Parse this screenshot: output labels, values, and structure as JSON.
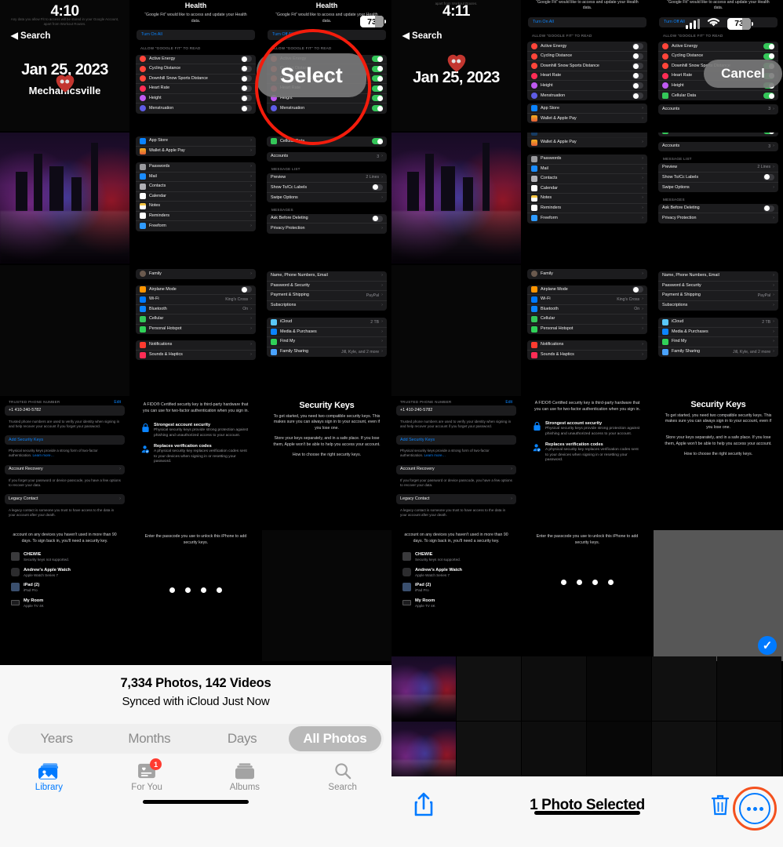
{
  "left_pane": {
    "lock_overlay": {
      "time": "4:10",
      "back_label": "Search",
      "date": "Jan 25, 2023",
      "location": "Mechanicsville",
      "faded_text": "Any data you allow Fit to access will be stored in your Google Account, apart from Workout Routes."
    },
    "health_sheet": {
      "nav_title": "Health",
      "subtitle": "“Google Fit” would like to access and update your Health data.",
      "turn_on_all": "Turn On All",
      "section_header": "ALLOW “GOOGLE FIT” TO READ",
      "items": [
        {
          "label": "Active Energy",
          "on": false
        },
        {
          "label": "Cycling Distance",
          "on": false
        },
        {
          "label": "Downhill Snow Sports Distance",
          "on": false
        },
        {
          "label": "Heart Rate",
          "on": false
        },
        {
          "label": "Height",
          "on": false
        },
        {
          "label": "Menstruation",
          "on": false
        }
      ]
    },
    "health_sheet_on": {
      "nav_title": "Health",
      "subtitle": "“Google Fit” would like to access and update your Health data.",
      "turn_off_all": "Turn Off All",
      "section_header": "ALLOW “GOOGLE FIT” TO READ",
      "items": [
        {
          "label": "Active Energy",
          "on": true
        },
        {
          "label": "Cycling Distance",
          "on": true
        },
        {
          "label": "Downhill Snow Sports Distance",
          "on": true
        },
        {
          "label": "Heart Rate",
          "on": true
        },
        {
          "label": "Height",
          "on": true
        },
        {
          "label": "Menstruation",
          "on": true
        }
      ]
    },
    "settings_apps": {
      "top_rows": [
        {
          "label": "App Store",
          "color": "#0b84ff"
        },
        {
          "label": "Wallet & Apple Pay",
          "color": "#8e8e93"
        }
      ],
      "group_rows": [
        {
          "label": "Passwords",
          "color": "#8e8e93"
        },
        {
          "label": "Mail",
          "color": "#1a8cff"
        },
        {
          "label": "Contacts",
          "color": "#b0b0b5"
        },
        {
          "label": "Calendar",
          "color": "#ffffff"
        },
        {
          "label": "Notes",
          "color": "#f5c542"
        },
        {
          "label": "Reminders",
          "color": "#ffffff"
        },
        {
          "label": "Freeform",
          "color": "#2f9bff"
        }
      ]
    },
    "settings_connectivity": {
      "family_label": "Family",
      "rows": [
        {
          "label": "Airplane Mode",
          "color": "#ff9500",
          "toggle": true,
          "on": false
        },
        {
          "label": "Wi-Fi",
          "color": "#007aff",
          "value": "King's Cross"
        },
        {
          "label": "Bluetooth",
          "color": "#0a84ff",
          "value": "On"
        },
        {
          "label": "Cellular",
          "color": "#34c759"
        },
        {
          "label": "Personal Hotspot",
          "color": "#30d158"
        }
      ],
      "notif_rows": [
        {
          "label": "Notifications",
          "color": "#ff3b30"
        },
        {
          "label": "Sounds & Haptics",
          "color": "#ff2d55"
        }
      ]
    },
    "settings_mail": {
      "cellular_data": {
        "label": "Cellular Data",
        "on": true
      },
      "accounts": {
        "label": "Accounts",
        "value": "3"
      },
      "message_list_header": "MESSAGE LIST",
      "message_list": [
        {
          "label": "Preview",
          "value": "2 Lines"
        },
        {
          "label": "Show To/Cc Labels",
          "toggle": true,
          "on": false
        },
        {
          "label": "Swipe Options"
        }
      ],
      "messages_header": "MESSAGES",
      "messages": [
        {
          "label": "Ask Before Deleting",
          "toggle": true,
          "on": false
        },
        {
          "label": "Privacy Protection"
        }
      ]
    },
    "settings_appleid": {
      "rows": [
        {
          "label": "Name, Phone Numbers, Email"
        },
        {
          "label": "Password & Security"
        },
        {
          "label": "Payment & Shipping",
          "value": "PayPal"
        },
        {
          "label": "Subscriptions"
        }
      ],
      "services": [
        {
          "label": "iCloud",
          "value": "2 TB",
          "color": "#5ac8fa"
        },
        {
          "label": "Media & Purchases",
          "color": "#0b84ff"
        },
        {
          "label": "Find My",
          "color": "#30d158"
        },
        {
          "label": "Family Sharing",
          "value": "Jill, Kyle, and 2 more",
          "color": "#4aa3ff"
        }
      ]
    },
    "password_security": {
      "trusted_header": "TRUSTED PHONE NUMBER",
      "edit_label": "Edit",
      "phone": "+1 410-240-5782",
      "phone_footer": "Trusted phone numbers are used to verify your identity when signing in and help recover your account if you forget your password.",
      "add_security_keys": "Add Security Keys",
      "add_footer": "Physical security keys provide a strong form of two-factor authentication.",
      "learn_more": "Learn more…",
      "account_recovery": "Account Recovery",
      "account_recovery_footer": "If you forget your password or device passcode, you have a few options to recover your data.",
      "legacy_contact": "Legacy Contact",
      "legacy_footer": "A legacy contact is someone you trust to have access to the data in your account after your death."
    },
    "fido_panel": {
      "intro": "A FIDO® Certified security key is third-party hardware that you can use for two-factor authentication when you sign in.",
      "features": [
        {
          "title": "Strongest account security",
          "body": "Physical security keys provide strong protection against phishing and unauthorized access to your account.",
          "icon": "lock-icon"
        },
        {
          "title": "Replaces verification codes",
          "body": "A physical security key replaces verification codes sent to your devices when signing in or resetting your password.",
          "icon": "verified-person-icon"
        }
      ]
    },
    "security_keys_panel": {
      "title": "Security Keys",
      "p1": "To get started, you need two compatible security keys. This makes sure you can always sign in to your account, even if you lose one.",
      "p2": "Store your keys separately, and in a safe place. If you lose them, Apple won't be able to help you access your account.",
      "link": "How to choose the right security keys."
    },
    "devices_panel": {
      "intro": "account on any devices you haven't used in more than 90 days. To sign back in, you'll need a security key.",
      "devices": [
        {
          "name": "CHEWIE",
          "sub": "Security keys not supported."
        },
        {
          "name": "Andrew's Apple Watch",
          "sub": "Apple Watch Series 7"
        },
        {
          "name": "iPad (2)",
          "sub": "iPad Pro"
        },
        {
          "name": "My Room",
          "sub": "Apple TV 4K"
        }
      ]
    },
    "passcode_panel": {
      "prompt": "Enter the passcode you use to unlock this iPhone to add security keys.",
      "dots": 4
    },
    "select_bubble": "Select",
    "status_bar": {
      "battery": "73"
    },
    "bottom_bar": {
      "count_line": "7,334 Photos, 142 Videos",
      "sync_line": "Synced with iCloud Just Now",
      "segments": [
        "Years",
        "Months",
        "Days",
        "All Photos"
      ],
      "active_segment": "All Photos",
      "tabs": [
        {
          "label": "Library",
          "icon": "photos-library-icon",
          "active": true,
          "badge": null
        },
        {
          "label": "For You",
          "icon": "for-you-icon",
          "active": false,
          "badge": "1"
        },
        {
          "label": "Albums",
          "icon": "albums-icon",
          "active": false,
          "badge": null
        },
        {
          "label": "Search",
          "icon": "search-icon",
          "active": false,
          "badge": null
        }
      ]
    }
  },
  "right_pane": {
    "lock_overlay": {
      "time": "4:11",
      "back_label": "Search",
      "date": "Jan 25, 2023"
    },
    "cancel_bubble": "Cancel",
    "selection_toolbar": {
      "title": "1 Photo Selected",
      "share_icon": "share-icon",
      "trash_icon": "trash-icon",
      "more_icon": "more-ellipsis-icon"
    }
  },
  "colors": {
    "accent_blue": "#007aff",
    "highlight_red": "#f41c0c",
    "highlight_orange": "#f4511e",
    "toggle_green": "#34c759",
    "badge_red": "#ff3b30"
  }
}
